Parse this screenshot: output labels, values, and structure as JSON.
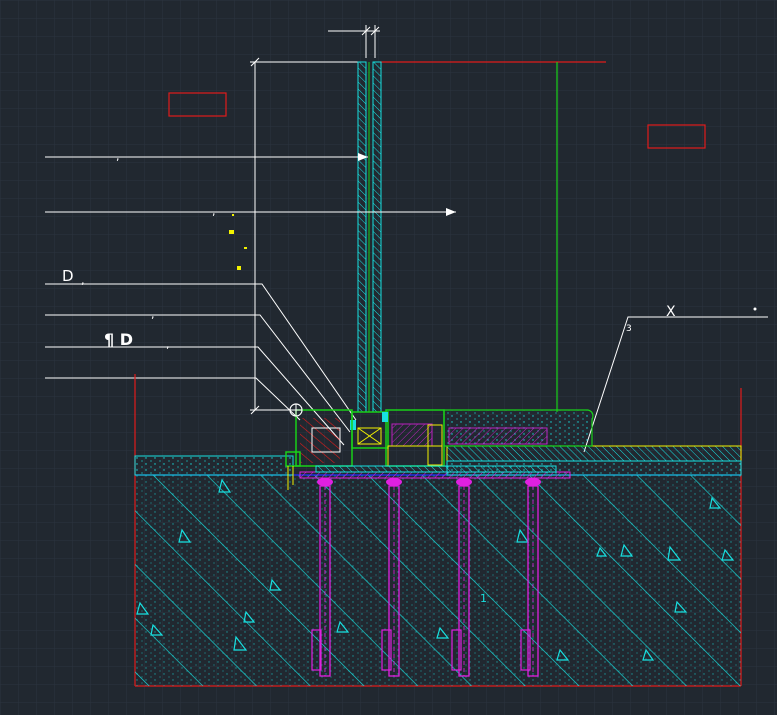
{
  "drawing": {
    "labels": {
      "top_right": "X",
      "top_right_index": "3",
      "leader_1": ",",
      "leader_2": ",",
      "leader_3_prefix": "D",
      "leader_3": ",",
      "leader_4": ",",
      "leader_5_prefix": "¶ D",
      "leader_5": ",",
      "note_1": "1"
    },
    "colors": {
      "background": "#212830",
      "grid": "#2c343f",
      "white": "#ffffff",
      "red": "#e01b1b",
      "green": "#19d019",
      "cyan": "#18e0e0",
      "magenta": "#e020e0",
      "yellow": "#f2f200",
      "blue": "#2030ff",
      "dark_red": "#c01818"
    }
  }
}
